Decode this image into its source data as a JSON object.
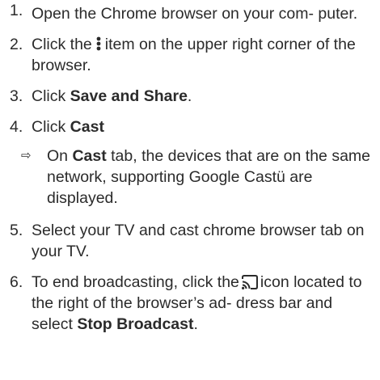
{
  "steps": [
    {
      "number": "1.",
      "text": "Open the Chrome browser on your com- puter."
    },
    {
      "number": "2.",
      "text_before": "Click the",
      "icon": "three-dot-menu-icon",
      "text_after": "item on the upper right corner of the browser."
    },
    {
      "number": "3.",
      "text_before": "Click ",
      "bold": "Save and Share",
      "text_after": "."
    },
    {
      "number": "4.",
      "text_before": "Click ",
      "bold": "Cast",
      "result": {
        "arrow": "⇨",
        "text_before": "On ",
        "bold": "Cast",
        "text_after": " tab, the devices that are on the same network, supporting Google Castü are displayed."
      }
    },
    {
      "number": "5.",
      "text": "Select your TV and cast chrome browser tab on your TV."
    },
    {
      "number": "6.",
      "text_before": "To end broadcasting, click the",
      "icon": "cast-icon",
      "text_middle": "icon located to the right of the browser’s ad- dress bar and select ",
      "bold": "Stop Broadcast",
      "text_after": "."
    }
  ],
  "colors": {
    "text": "#2b2b2b",
    "background": "#ffffff"
  }
}
